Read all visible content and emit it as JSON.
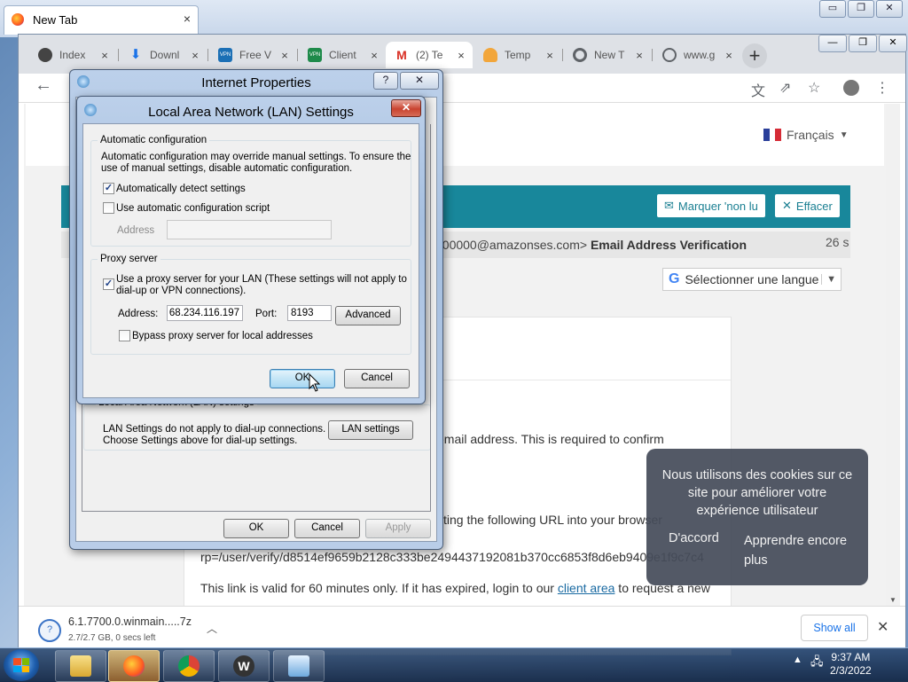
{
  "firefox": {
    "tab_title": "New Tab",
    "close_glyph": "×",
    "controls": [
      "▭",
      "❐",
      "✕"
    ]
  },
  "chrome": {
    "tabs": [
      {
        "label": "Index",
        "icon_color": "#444",
        "icon": "ghost-icon"
      },
      {
        "label": "Downl",
        "icon_color": "#1a73e8",
        "icon": "download-icon"
      },
      {
        "label": "Free V",
        "icon_color": "#1b6fb5",
        "icon": "vpn-icon"
      },
      {
        "label": "Client",
        "icon_color": "#1e8a4a",
        "icon": "vpn-icon"
      },
      {
        "label": "(2) Te",
        "icon_color": "#d93025",
        "icon": "gmail-icon"
      },
      {
        "label": "Temp",
        "icon_color": "#f2a63b",
        "icon": "temp-mail-icon"
      },
      {
        "label": "New T",
        "icon_color": "#5f6368",
        "icon": "chrome-icon"
      },
      {
        "label": "www.g",
        "icon_color": "#5f6368",
        "icon": "globe-icon"
      }
    ],
    "new_tab_glyph": "+",
    "controls": [
      "—",
      "❐",
      "✕"
    ]
  },
  "page": {
    "language": "Français",
    "mark_unread_label": "Marquer 'non lu",
    "delete_label": "Effacer",
    "email_sender": "000000@amazonses.com>",
    "email_subject": "Email Address Verification",
    "time_ago": "26 s",
    "translate_label": "Sélectionner une langue",
    "body_line1": "email address. This is required to confirm",
    "body_line2": "sting the following URL into your browser",
    "body_url": "rp=/user/verify/d8514ef9659b2128c333be2494437192081b370cc6853f8d6eb9409e1f9c7c4",
    "body_line3_pre": "This link is valid for 60 minutes only. If it has expired, login to our ",
    "body_line3_link": "client area",
    "body_line3_post": " to request a new"
  },
  "cookie": {
    "message": "Nous utilisons des cookies sur ce site pour améliorer votre expérience utilisateur",
    "accept": "D'accord",
    "learn_more": "Apprendre encore plus"
  },
  "download": {
    "filename": "6.1.7700.0.winmain.....7z",
    "status": "2.7/2.7 GB, 0 secs left",
    "show_all": "Show all"
  },
  "internet_properties": {
    "title": "Internet Properties",
    "help_glyph": "?",
    "close_glyph": "✕",
    "lan_group_label": "Local Area Network (LAN) settings",
    "lan_text": "LAN Settings do not apply to dial-up connections.\nChoose Settings above for dial-up settings.",
    "lan_button": "LAN settings",
    "ok": "OK",
    "cancel": "Cancel",
    "apply": "Apply"
  },
  "lan_settings": {
    "title": "Local Area Network (LAN) Settings",
    "close_glyph": "✕",
    "auto_group_label": "Automatic configuration",
    "auto_text": "Automatic configuration may override manual settings.  To ensure the\nuse of manual settings, disable automatic configuration.",
    "auto_detect_label": "Automatically detect settings",
    "auto_detect_checked": true,
    "auto_script_label": "Use automatic configuration script",
    "auto_script_checked": false,
    "address_label": "Address",
    "address_value": "",
    "proxy_group_label": "Proxy server",
    "use_proxy_label": "Use a proxy server for your LAN (These settings will not apply to\ndial-up or VPN connections).",
    "use_proxy_checked": true,
    "proxy_address_label": "Address:",
    "proxy_address_value": "68.234.116.197",
    "port_label": "Port:",
    "port_value": "8193",
    "advanced_button": "Advanced",
    "bypass_label": "Bypass proxy server for local addresses",
    "bypass_checked": false,
    "ok": "OK",
    "cancel": "Cancel"
  },
  "taskbar": {
    "apps": [
      "explorer",
      "firefox",
      "chrome",
      "winrar",
      "network-control-panel"
    ],
    "time": "9:37 AM",
    "date": "2/3/2022"
  }
}
